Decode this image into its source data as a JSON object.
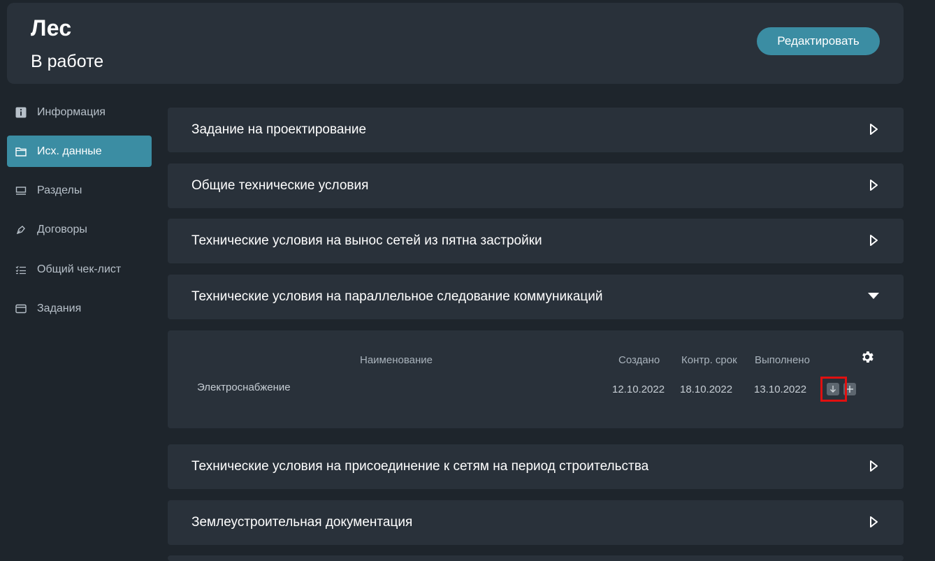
{
  "header": {
    "title": "Лес",
    "status": "В работе",
    "edit_label": "Редактировать"
  },
  "sidebar": {
    "items": [
      {
        "label": "Информация",
        "icon": "info-icon",
        "active": false
      },
      {
        "label": "Исх. данные",
        "icon": "folder-icon",
        "active": true
      },
      {
        "label": "Разделы",
        "icon": "sections-icon",
        "active": false
      },
      {
        "label": "Договоры",
        "icon": "pen-icon",
        "active": false
      },
      {
        "label": "Общий чек-лист",
        "icon": "checklist-icon",
        "active": false
      },
      {
        "label": "Задания",
        "icon": "tasks-icon",
        "active": false
      }
    ]
  },
  "panels": [
    {
      "label": "Задание на проектирование",
      "expanded": false
    },
    {
      "label": "Общие технические условия",
      "expanded": false
    },
    {
      "label": "Технические условия на вынос сетей из пятна застройки",
      "expanded": false
    },
    {
      "label": "Технические условия на параллельное следование коммуникаций",
      "expanded": true
    },
    {
      "label": "Технические условия на присоединение к сетям на период строительства",
      "expanded": false
    },
    {
      "label": "Землеустроительная документация",
      "expanded": false
    }
  ],
  "table": {
    "columns": [
      "Наименование",
      "Создано",
      "Контр. срок",
      "Выполнено"
    ],
    "rows": [
      {
        "name": "Электроснабжение",
        "created": "12.10.2022",
        "deadline": "18.10.2022",
        "done": "13.10.2022"
      }
    ]
  },
  "colors": {
    "accent": "#3b8da3",
    "background": "#1e252c",
    "panel": "#29313a",
    "highlight": "#e01010"
  }
}
